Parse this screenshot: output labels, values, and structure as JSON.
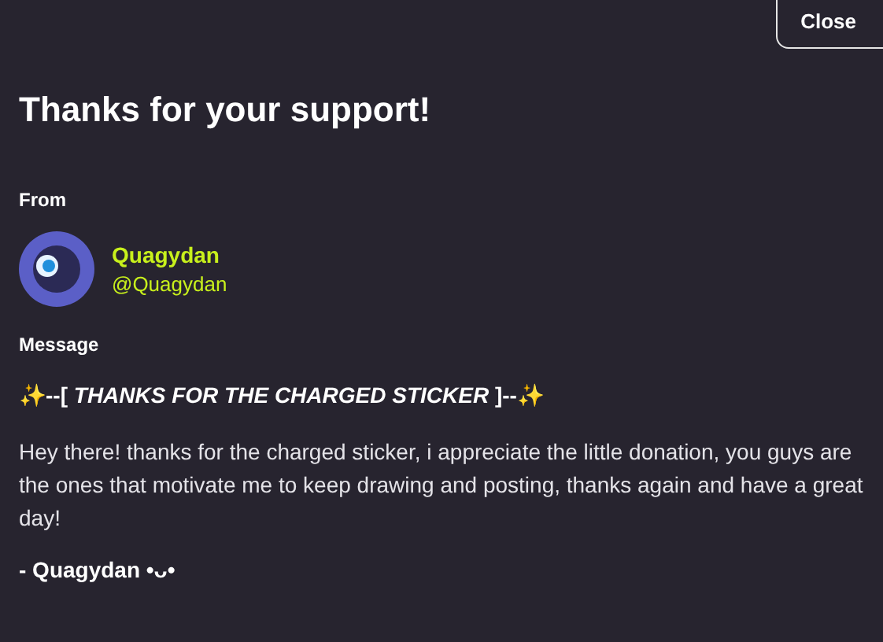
{
  "close_button": {
    "label": "Close"
  },
  "title": "Thanks for your support!",
  "from": {
    "label": "From",
    "name": "Quagydan",
    "handle": "@Quagydan"
  },
  "message": {
    "label": "Message",
    "heading": "✨--[ *THANKS FOR THE CHARGED STICKER* ]--✨",
    "body": "Hey there! thanks for the charged sticker, i appreciate the little donation, you guys are the ones that motivate me to keep drawing and posting, thanks again and have a great day!",
    "signature": "- Quagydan •ᴗ•"
  }
}
